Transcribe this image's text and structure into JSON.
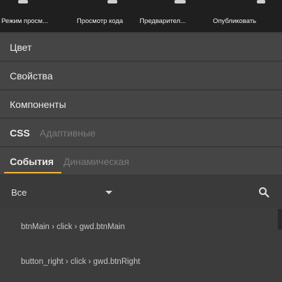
{
  "toolbar": {
    "items": [
      "Режим просм...",
      "Просмотр кода",
      "Предварител...",
      "Опубликовать"
    ]
  },
  "sections": {
    "color": "Цвет",
    "properties": "Свойства",
    "components": "Компоненты",
    "css": "CSS",
    "adaptive": "Адаптивные",
    "events": "События",
    "dynamic": "Динамическая"
  },
  "filter": {
    "selected": "Все",
    "search_icon": "search-icon"
  },
  "events": [
    "btnMain › click › gwd.btnMain",
    "button_right › click › gwd.btnRight"
  ],
  "colors": {
    "accent": "#f2b53c",
    "panel": "#454545",
    "background": "#3c3c3c"
  }
}
